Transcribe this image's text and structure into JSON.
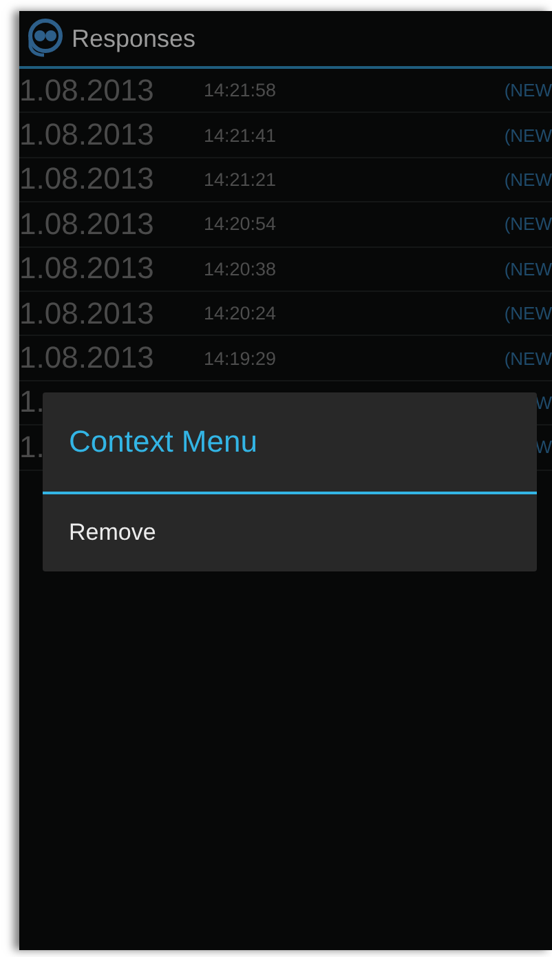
{
  "action_bar": {
    "title": "Responses"
  },
  "rows": [
    {
      "date": "1.08.2013",
      "time": "14:21:58",
      "status": "(NEW"
    },
    {
      "date": "1.08.2013",
      "time": "14:21:41",
      "status": "(NEW"
    },
    {
      "date": "1.08.2013",
      "time": "14:21:21",
      "status": "(NEW"
    },
    {
      "date": "1.08.2013",
      "time": "14:20:54",
      "status": "(NEW"
    },
    {
      "date": "1.08.2013",
      "time": "14:20:38",
      "status": "(NEW"
    },
    {
      "date": "1.08.2013",
      "time": "14:20:24",
      "status": "(NEW"
    },
    {
      "date": "1.08.2013",
      "time": "14:19:29",
      "status": "(NEW"
    },
    {
      "date": "1.",
      "status": "W"
    },
    {
      "date": "1.",
      "status": "W"
    }
  ],
  "context_menu": {
    "title": "Context Menu",
    "items": [
      "Remove"
    ]
  }
}
